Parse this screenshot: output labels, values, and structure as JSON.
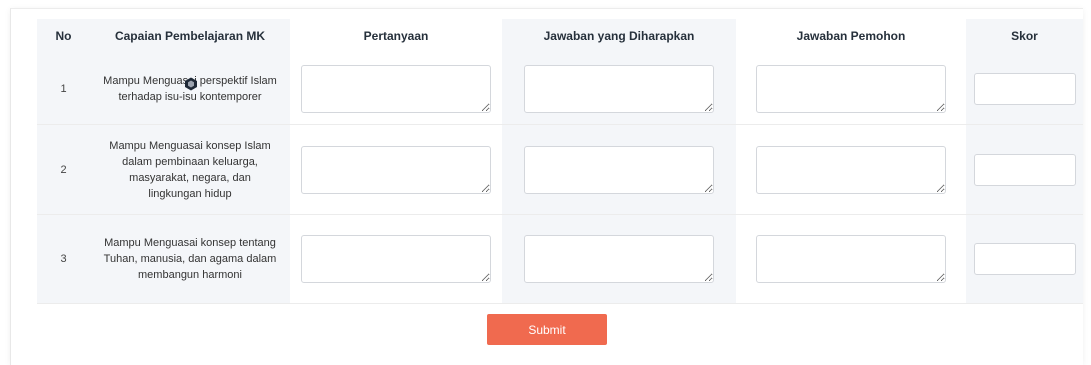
{
  "table": {
    "headers": {
      "no": "No",
      "cpmk": "Capaian Pembelajaran MK",
      "question": "Pertanyaan",
      "expected": "Jawaban yang Diharapkan",
      "applicant": "Jawaban Pemohon",
      "score": "Skor"
    },
    "rows": [
      {
        "no": "1",
        "cpmk": "Mampu Menguasai perspektif Islam terhadap isu-isu kontemporer"
      },
      {
        "no": "2",
        "cpmk": "Mampu Menguasai konsep Islam dalam pembinaan keluarga, masyarakat, negara, dan lingkungan hidup"
      },
      {
        "no": "3",
        "cpmk": "Mampu Menguasai konsep tentang Tuhan, manusia, dan agama dalam membangun harmoni"
      }
    ]
  },
  "form": {
    "submit_label": "Submit",
    "accent_color": "#f06a4f",
    "header_shade_color": "#f4f6f9"
  },
  "icons": {
    "cursor": "cursor-hex-icon"
  }
}
